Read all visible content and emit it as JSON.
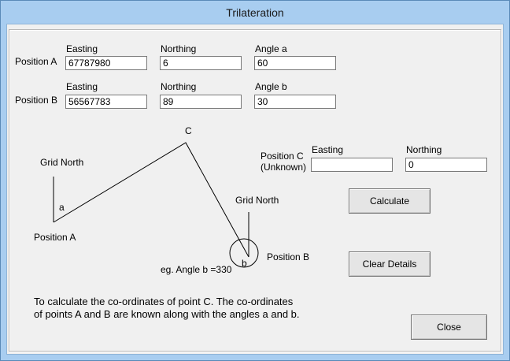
{
  "window": {
    "title": "Trilateration"
  },
  "position_a": {
    "label": "Position A",
    "easting_label": "Easting",
    "easting_value": "67787980",
    "northing_label": "Northing",
    "northing_value": "6",
    "angle_label": "Angle a",
    "angle_value": "60"
  },
  "position_b": {
    "label": "Position B",
    "easting_label": "Easting",
    "easting_value": "56567783",
    "northing_label": "Northing",
    "northing_value": "89",
    "angle_label": "Angle b",
    "angle_value": "30"
  },
  "position_c": {
    "label_line1": "Position C",
    "label_line2": "(Unknown)",
    "easting_label": "Easting",
    "easting_value": "",
    "northing_label": "Northing",
    "northing_value": "0"
  },
  "diagram": {
    "point_c": "C",
    "grid_north_left": "Grid North",
    "angle_a": "a",
    "position_a": "Position A",
    "grid_north_right": "Grid North",
    "angle_b": "b",
    "position_b": "Position B",
    "example": "eg. Angle b =330"
  },
  "buttons": {
    "calculate": "Calculate",
    "clear": "Clear Details",
    "close": "Close"
  },
  "note": "To calculate the co-ordinates of point C. The co-ordinates of points A and B are known along with the angles a and b."
}
